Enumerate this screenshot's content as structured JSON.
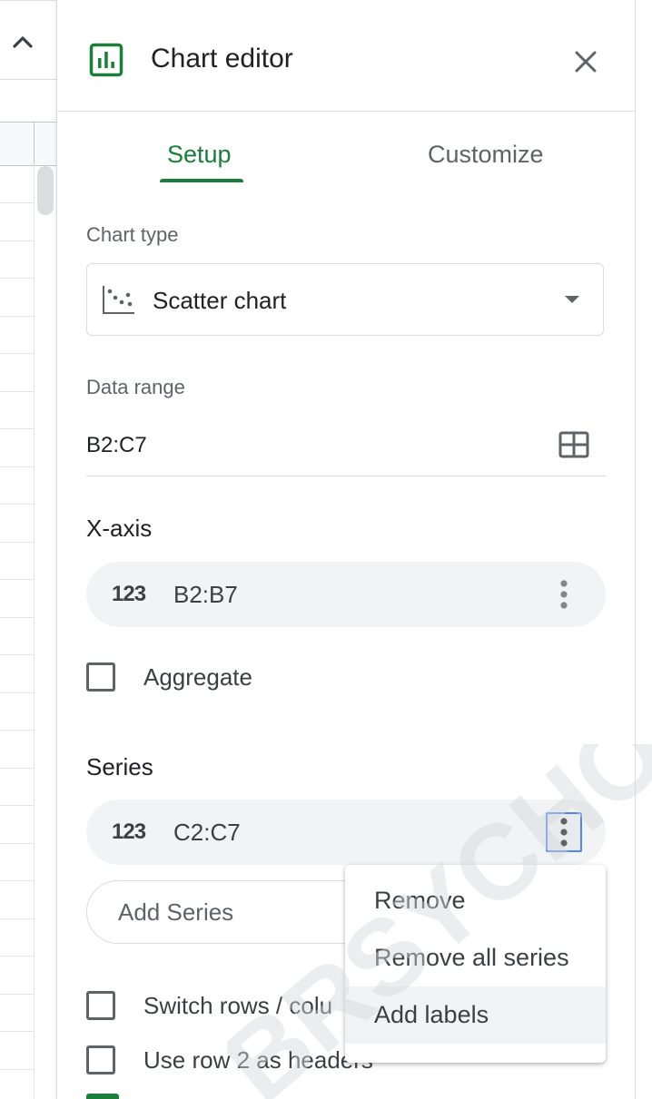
{
  "panel": {
    "title": "Chart editor"
  },
  "tabs": [
    {
      "label": "Setup"
    },
    {
      "label": "Customize"
    }
  ],
  "chart_type": {
    "label": "Chart type",
    "value": "Scatter chart"
  },
  "data_range": {
    "label": "Data range",
    "value": "B2:C7"
  },
  "x_axis": {
    "heading": "X-axis",
    "chip_icon": "123",
    "range": "B2:B7"
  },
  "aggregate": {
    "label": "Aggregate",
    "checked": false
  },
  "series": {
    "heading": "Series",
    "chip_icon": "123",
    "range": "C2:C7",
    "add_label": "Add Series"
  },
  "options": {
    "switch_rows": "Switch rows / colu",
    "use_row_headers": "Use row 2 as headers"
  },
  "context_menu": {
    "items": [
      {
        "label": "Remove"
      },
      {
        "label": "Remove all series"
      },
      {
        "label": "Add labels"
      }
    ]
  },
  "watermark": {
    "text": "BRSYCHOL"
  },
  "colors": {
    "accent_green": "#188038",
    "focus_blue": "#4a8af4",
    "chip_bg": "#f1f3f4"
  }
}
